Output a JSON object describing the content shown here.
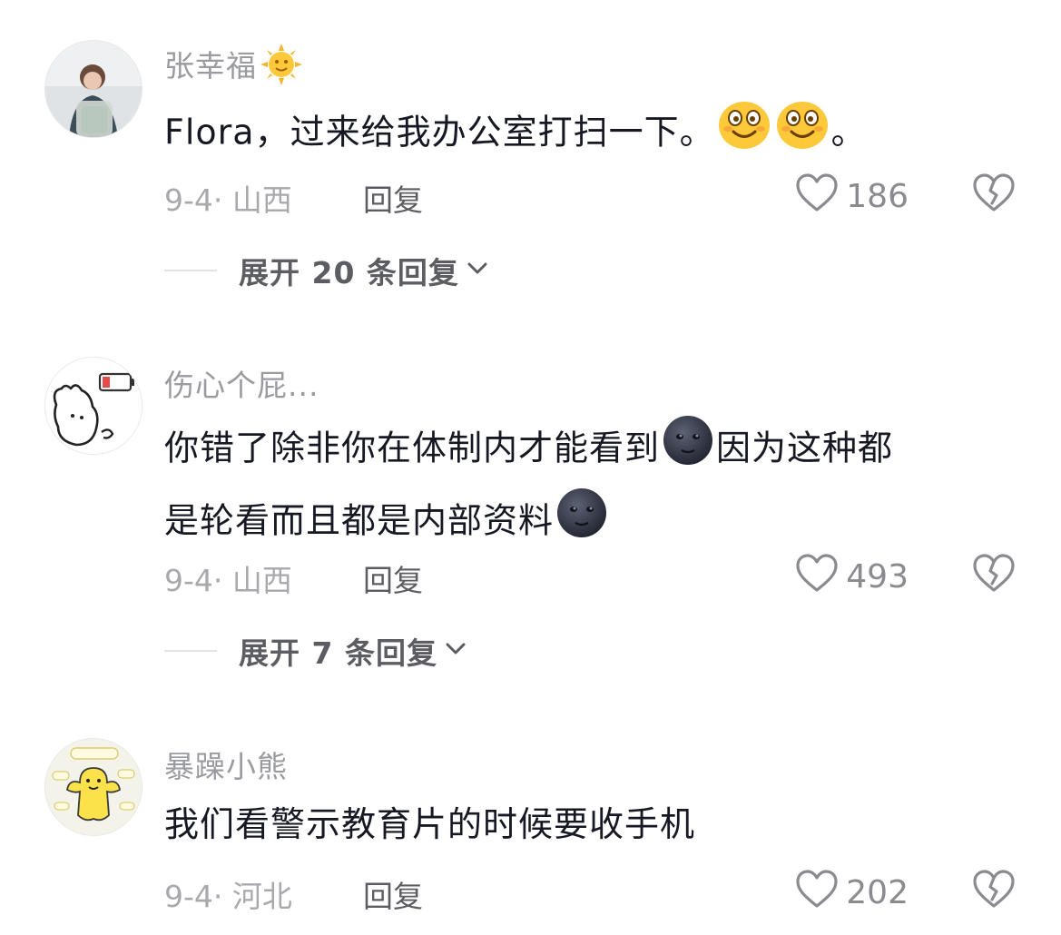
{
  "comments": [
    {
      "username": "张幸福",
      "username_emoji": "sun-with-face",
      "content_prefix": "Flora，过来给我办公室打扫一下。",
      "content_emoji": [
        "smiling-face-icon",
        "smiling-face-icon"
      ],
      "content_suffix": "。",
      "meta": "9-4· 山西",
      "reply": "回复",
      "likes": "186",
      "expand": "展开 20 条回复"
    },
    {
      "username": "伤心个屁...",
      "content_line1_prefix": "你错了除非你在体制内才能看到",
      "content_line1_suffix": "因为这种都",
      "content_line2": "是轮看而且都是内部资料",
      "meta": "9-4· 山西",
      "reply": "回复",
      "likes": "493",
      "expand": "展开 7 条回复"
    },
    {
      "username": "暴躁小熊",
      "content": "我们看警示教育片的时候要收手机",
      "meta": "9-4· 河北",
      "reply": "回复",
      "likes": "202"
    }
  ],
  "colors": {
    "username": "#9a9ba0",
    "meta": "#a8a9ad",
    "reply": "#5c5d63",
    "icon": "#8a8b90"
  }
}
